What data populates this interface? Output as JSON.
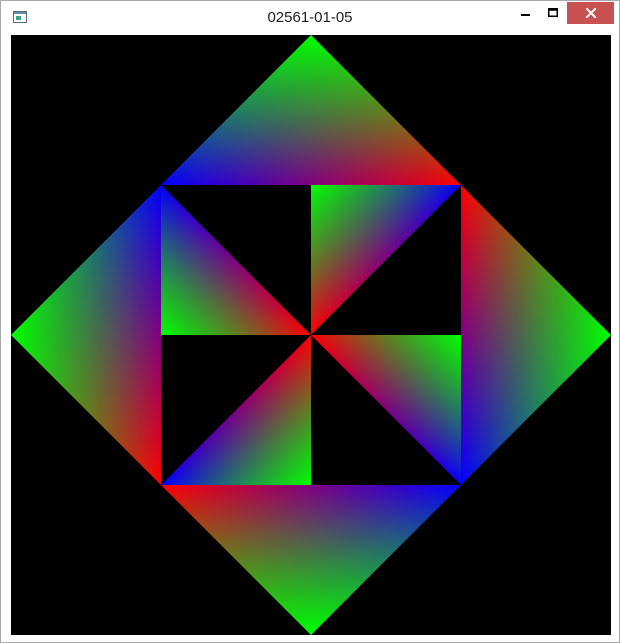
{
  "window": {
    "title": "02561-01-05",
    "icon": "app-window-icon",
    "controls": {
      "minimize_icon": "minimize-icon",
      "maximize_icon": "maximize-icon",
      "close_icon": "close-icon"
    },
    "colors": {
      "close_button": "#c75050",
      "canvas_background": "#000000"
    }
  },
  "canvas": {
    "description_colors": {
      "red": "#ff0000",
      "green": "#00ff00",
      "blue": "#0000ff"
    }
  }
}
